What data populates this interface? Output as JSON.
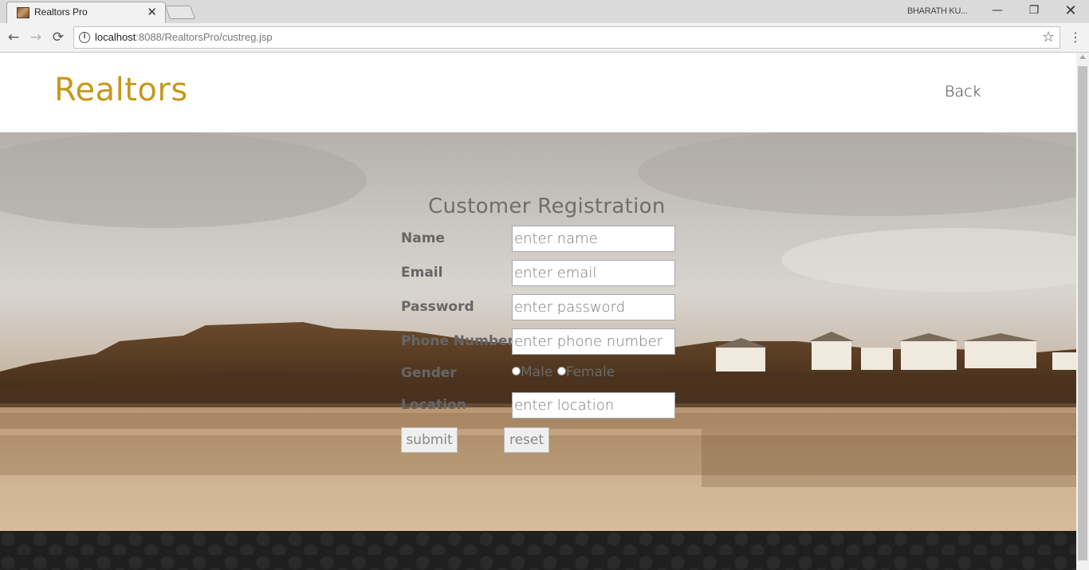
{
  "browser": {
    "tab_title": "Realtors Pro",
    "tab_close": "✕",
    "profile_name": "BHARATH KU...",
    "url_host": "localhost",
    "url_rest": ":8088/RealtorsPro/custreg.jsp",
    "win_min": "—",
    "win_max": "❐",
    "win_close": "✕",
    "back": "←",
    "forward": "→",
    "reload": "⟳",
    "star": "☆",
    "menu": "⋮",
    "info": "i"
  },
  "header": {
    "brand": "Realtors",
    "back_link": "Back"
  },
  "form": {
    "title": "Customer Registration",
    "name_label": "Name",
    "name_placeholder": "enter name",
    "email_label": "Email",
    "email_placeholder": "enter email",
    "password_label": "Password",
    "password_placeholder": "enter password",
    "phone_label": "Phone Number",
    "phone_placeholder": "enter phone number",
    "gender_label": "Gender",
    "gender_male": "Male",
    "gender_female": "Female",
    "location_label": "Location",
    "location_placeholder": "enter location",
    "submit": "submit",
    "reset": "reset"
  },
  "colors": {
    "brand": "#c6981c",
    "footer": "#1f1f1f"
  },
  "icons": [
    "favicon-icon",
    "close-icon",
    "back-arrow-icon",
    "forward-arrow-icon",
    "reload-icon",
    "info-icon",
    "star-icon",
    "menu-icon"
  ]
}
